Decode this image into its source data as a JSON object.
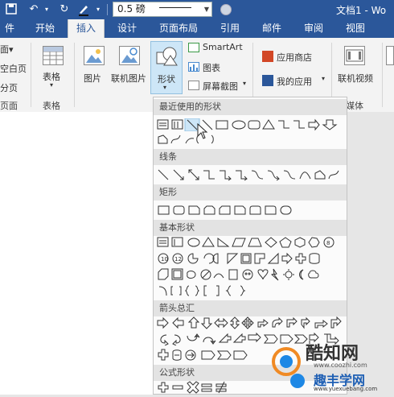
{
  "title_bar": {
    "font_size_value": "0.5 磅",
    "title": "文档1 - Wo"
  },
  "tabs": [
    {
      "label": "件"
    },
    {
      "label": "开始"
    },
    {
      "label": "插入"
    },
    {
      "label": "设计"
    },
    {
      "label": "页面布局"
    },
    {
      "label": "引用"
    },
    {
      "label": "邮件"
    },
    {
      "label": "审阅"
    },
    {
      "label": "视图"
    }
  ],
  "ribbon": {
    "pages_group": {
      "items": [
        "面▾",
        "空白页",
        "分页"
      ],
      "label": "页面"
    },
    "tables_group": {
      "button": "表格",
      "label": "表格"
    },
    "illustrations": {
      "picture": "图片",
      "online_picture": "联机图片",
      "shapes": "形状",
      "smartart": "SmartArt",
      "chart": "图表",
      "screenshot": "屏幕截图"
    },
    "apps": {
      "store": "应用商店",
      "my_apps": "我的应用"
    },
    "media": {
      "online_video": "联机视频",
      "label": "媒体"
    }
  },
  "shapes_panel": {
    "sections": [
      {
        "title": "最近使用的形状"
      },
      {
        "title": "线条"
      },
      {
        "title": "矩形"
      },
      {
        "title": "基本形状"
      },
      {
        "title": "箭头总汇"
      },
      {
        "title": "公式形状"
      }
    ]
  },
  "watermark": {
    "name": "酷知网",
    "url": "www.coozhi.com",
    "sub": "趣丰学网",
    "sub_url": "www.yuexuebang.com"
  },
  "colors": {
    "accent": "#2b579a",
    "ribbon_bg": "#f3f3f3",
    "hover": "#cde6f7",
    "section_bg": "#e3e3e3"
  }
}
